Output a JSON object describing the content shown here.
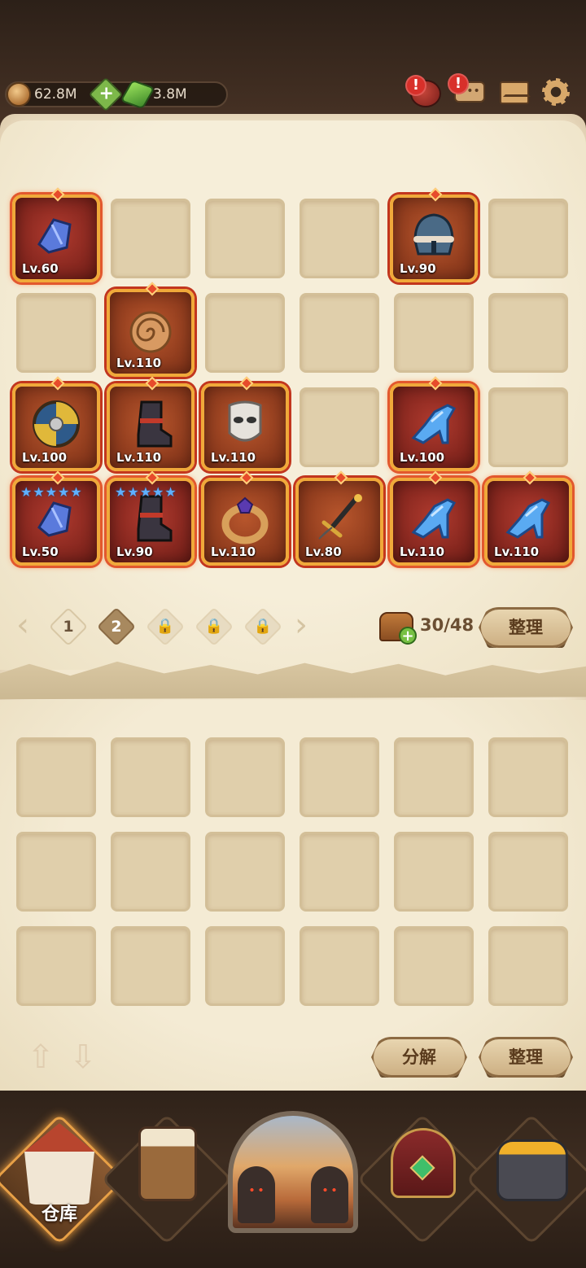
{
  "currency": {
    "gold_value": "62.8M",
    "gem_value": "3.8M",
    "add_label": "+"
  },
  "alerts": {
    "bag_badge": "!",
    "chat_badge": "!"
  },
  "icons": {
    "gold": "gold-coin-icon",
    "gem": "green-gem-icon",
    "bag": "treasure-bag-icon",
    "chat": "chat-icon",
    "mail": "mail-icon",
    "settings": "gear-icon"
  },
  "inventory": {
    "items": [
      {
        "icon": "gauntlet-icon",
        "level": "Lv.60",
        "rarity": "red",
        "stars": 0
      },
      {
        "icon": "helmet-icon",
        "level": "Lv.90",
        "rarity": "orange",
        "stars": 0
      },
      {
        "icon": "amulet-icon",
        "level": "Lv.110",
        "rarity": "orange",
        "stars": 0
      },
      {
        "icon": "shield-icon",
        "level": "Lv.100",
        "rarity": "orange",
        "stars": 0
      },
      {
        "icon": "boots-icon",
        "level": "Lv.110",
        "rarity": "orange",
        "stars": 0
      },
      {
        "icon": "mask-icon",
        "level": "Lv.110",
        "rarity": "orange",
        "stars": 0
      },
      {
        "icon": "glass-slipper-icon",
        "level": "Lv.100",
        "rarity": "red",
        "stars": 0
      },
      {
        "icon": "gauntlet-icon",
        "level": "Lv.50",
        "rarity": "red",
        "stars": 5
      },
      {
        "icon": "boots-icon",
        "level": "Lv.90",
        "rarity": "red",
        "stars": 5
      },
      {
        "icon": "ring-icon",
        "level": "Lv.110",
        "rarity": "orange",
        "stars": 0
      },
      {
        "icon": "dagger-icon",
        "level": "Lv.80",
        "rarity": "orange",
        "stars": 0
      },
      {
        "icon": "glass-slipper-icon",
        "level": "Lv.110",
        "rarity": "red",
        "stars": 0
      },
      {
        "icon": "glass-slipper-icon",
        "level": "Lv.110",
        "rarity": "red",
        "stars": 0
      }
    ],
    "capacity": "30/48",
    "sort_label": "整理"
  },
  "pagination": {
    "pages": [
      "1",
      "2"
    ],
    "current": "2",
    "locked_count": 3,
    "prev": "‹",
    "next": "›"
  },
  "lower": {
    "dismantle_label": "分解",
    "sort_label": "整理"
  },
  "nav": {
    "items": [
      {
        "label": "仓库",
        "icon": "warehouse-icon",
        "active": true
      },
      {
        "label": "",
        "icon": "tavern-mug-icon",
        "active": false
      },
      {
        "label": "",
        "icon": "adventure-portal-icon",
        "active": false
      },
      {
        "label": "",
        "icon": "treasure-chest-icon",
        "active": false
      },
      {
        "label": "",
        "icon": "forge-anvil-icon",
        "active": false
      }
    ]
  },
  "colors": {
    "parchment": "#f2e7cf",
    "slot": "#e0cfab",
    "rarity_red": "#b03a2e",
    "rarity_orange": "#b8562c",
    "accent_gold": "#f0a93a"
  }
}
